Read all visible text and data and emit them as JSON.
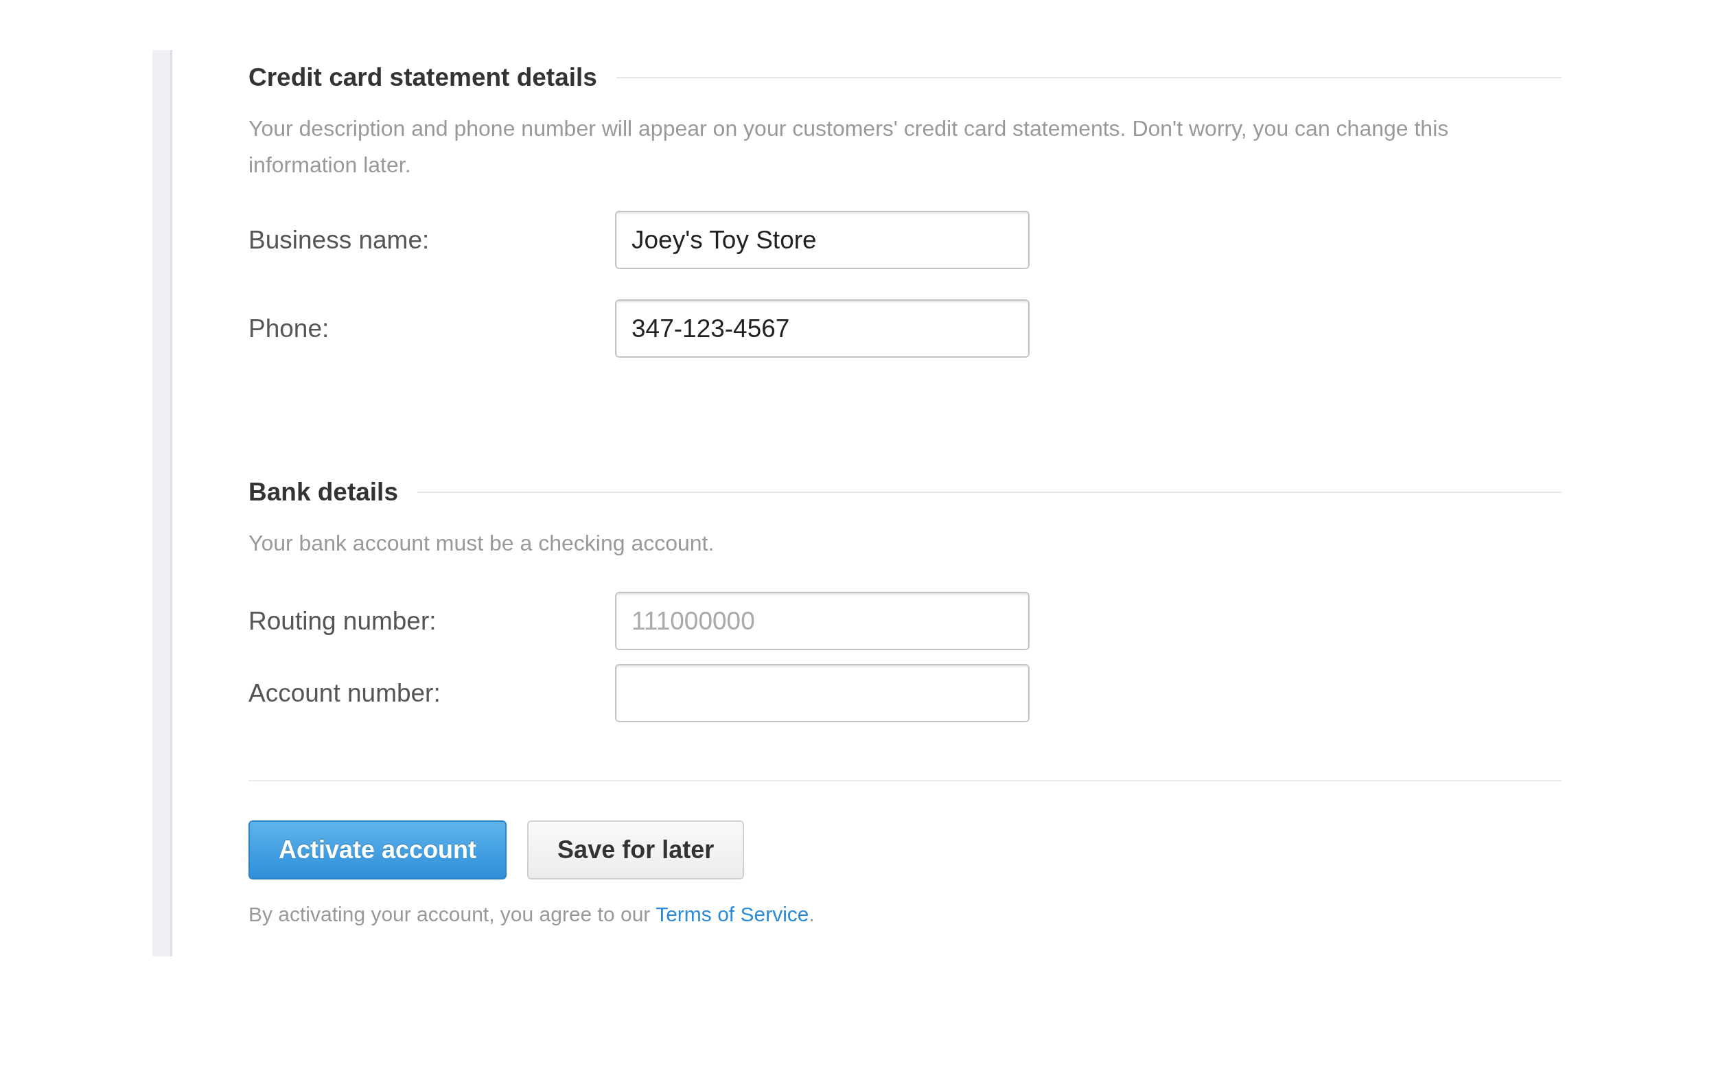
{
  "sections": [
    {
      "title": "Credit card statement details",
      "description": "Your description and phone number will appear on your customers' credit card statements. Don't worry, you can change this information later.",
      "fields": [
        {
          "label": "Business name:",
          "value": "Joey's Toy Store"
        },
        {
          "label": "Phone:",
          "value": "347-123-4567"
        }
      ]
    },
    {
      "title": "Bank details",
      "description": "Your bank account must be a checking account.",
      "fields": [
        {
          "label": "Routing number:",
          "placeholder": "111000000"
        },
        {
          "label": "Account number:"
        }
      ]
    }
  ],
  "buttons": [
    {
      "label": "Activate account",
      "kind": "primary"
    },
    {
      "label": "Save for later",
      "kind": "secondary"
    }
  ],
  "notice": {
    "text": "By activating your account, you agree to our",
    "link": "Terms of Service",
    "end": "."
  }
}
